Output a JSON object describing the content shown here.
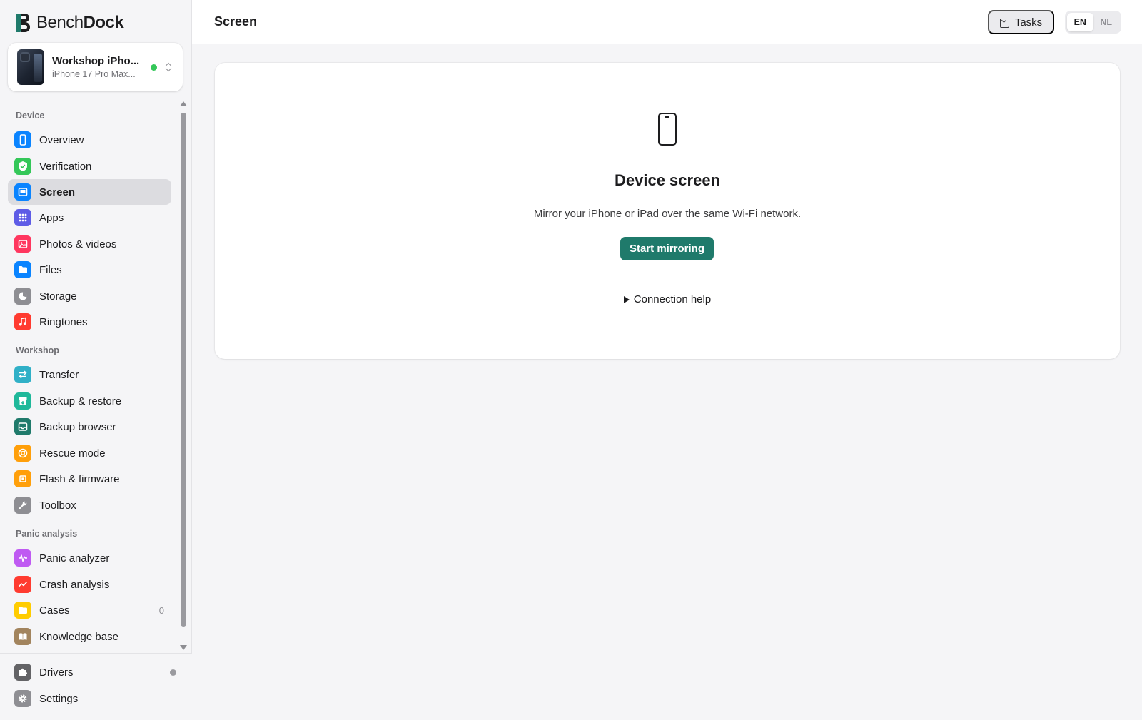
{
  "app": {
    "logo_text_a": "Bench",
    "logo_text_b": "Dock",
    "brand_color": "#1f7a6b"
  },
  "device": {
    "name": "Workshop iPho...",
    "model": "iPhone 17 Pro Max...",
    "status": "connected",
    "status_color": "#34c759"
  },
  "sidebar": {
    "sections": [
      {
        "label": "Device"
      },
      {
        "label": "Workshop"
      },
      {
        "label": "Panic analysis"
      }
    ],
    "items": [
      {
        "label": "Overview",
        "icon": "phone-icon",
        "color": "#0a84ff"
      },
      {
        "label": "Verification",
        "icon": "shield-check-icon",
        "color": "#34c759"
      },
      {
        "label": "Screen",
        "icon": "screen-icon",
        "color": "#0a84ff",
        "active": true
      },
      {
        "label": "Apps",
        "icon": "grid-icon",
        "color": "#5e5ce6"
      },
      {
        "label": "Photos & videos",
        "icon": "photo-icon",
        "color": "#ff375f"
      },
      {
        "label": "Files",
        "icon": "folder-icon",
        "color": "#0a84ff"
      },
      {
        "label": "Storage",
        "icon": "pie-chart-icon",
        "color": "#8e8e93"
      },
      {
        "label": "Ringtones",
        "icon": "music-note-icon",
        "color": "#ff3b30"
      },
      {
        "label": "Transfer",
        "icon": "transfer-arrows-icon",
        "color": "#30b0c7"
      },
      {
        "label": "Backup & restore",
        "icon": "archive-icon",
        "color": "#1fb89a"
      },
      {
        "label": "Backup browser",
        "icon": "tray-icon",
        "color": "#1f7a6b"
      },
      {
        "label": "Rescue mode",
        "icon": "lifebuoy-icon",
        "color": "#ff9f0a"
      },
      {
        "label": "Flash & firmware",
        "icon": "chip-icon",
        "color": "#ff9f0a"
      },
      {
        "label": "Toolbox",
        "icon": "wrench-icon",
        "color": "#8e8e93"
      },
      {
        "label": "Panic analyzer",
        "icon": "waveform-icon",
        "color": "#bf5af2"
      },
      {
        "label": "Crash analysis",
        "icon": "trend-icon",
        "color": "#ff3b30"
      },
      {
        "label": "Cases",
        "icon": "folder-icon",
        "color": "#ffcc00",
        "count": "0"
      },
      {
        "label": "Knowledge base",
        "icon": "book-icon",
        "color": "#a2845e"
      }
    ],
    "footer": [
      {
        "label": "Drivers",
        "icon": "puzzle-icon",
        "color": "#636366"
      },
      {
        "label": "Settings",
        "icon": "gear-icon",
        "color": "#8e8e93"
      }
    ]
  },
  "header": {
    "title": "Screen",
    "tasks_label": "Tasks",
    "languages": [
      "EN",
      "NL"
    ],
    "selected_language": "EN"
  },
  "main": {
    "title": "Device screen",
    "description": "Mirror your iPhone or iPad over the same Wi-Fi network.",
    "primary_button": "Start mirroring",
    "help_label": "Connection help"
  }
}
